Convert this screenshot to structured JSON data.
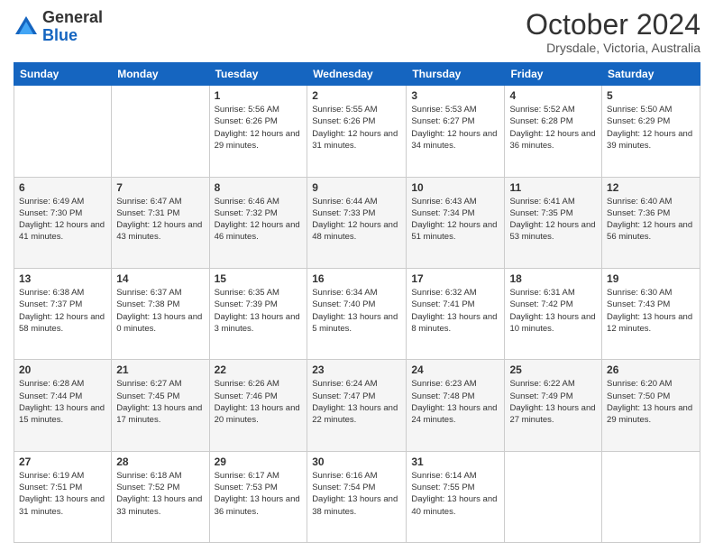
{
  "header": {
    "logo_general": "General",
    "logo_blue": "Blue",
    "month_title": "October 2024",
    "location": "Drysdale, Victoria, Australia"
  },
  "calendar": {
    "days_of_week": [
      "Sunday",
      "Monday",
      "Tuesday",
      "Wednesday",
      "Thursday",
      "Friday",
      "Saturday"
    ],
    "weeks": [
      [
        {
          "day": "",
          "info": ""
        },
        {
          "day": "",
          "info": ""
        },
        {
          "day": "1",
          "info": "Sunrise: 5:56 AM\nSunset: 6:26 PM\nDaylight: 12 hours and 29 minutes."
        },
        {
          "day": "2",
          "info": "Sunrise: 5:55 AM\nSunset: 6:26 PM\nDaylight: 12 hours and 31 minutes."
        },
        {
          "day": "3",
          "info": "Sunrise: 5:53 AM\nSunset: 6:27 PM\nDaylight: 12 hours and 34 minutes."
        },
        {
          "day": "4",
          "info": "Sunrise: 5:52 AM\nSunset: 6:28 PM\nDaylight: 12 hours and 36 minutes."
        },
        {
          "day": "5",
          "info": "Sunrise: 5:50 AM\nSunset: 6:29 PM\nDaylight: 12 hours and 39 minutes."
        }
      ],
      [
        {
          "day": "6",
          "info": "Sunrise: 6:49 AM\nSunset: 7:30 PM\nDaylight: 12 hours and 41 minutes."
        },
        {
          "day": "7",
          "info": "Sunrise: 6:47 AM\nSunset: 7:31 PM\nDaylight: 12 hours and 43 minutes."
        },
        {
          "day": "8",
          "info": "Sunrise: 6:46 AM\nSunset: 7:32 PM\nDaylight: 12 hours and 46 minutes."
        },
        {
          "day": "9",
          "info": "Sunrise: 6:44 AM\nSunset: 7:33 PM\nDaylight: 12 hours and 48 minutes."
        },
        {
          "day": "10",
          "info": "Sunrise: 6:43 AM\nSunset: 7:34 PM\nDaylight: 12 hours and 51 minutes."
        },
        {
          "day": "11",
          "info": "Sunrise: 6:41 AM\nSunset: 7:35 PM\nDaylight: 12 hours and 53 minutes."
        },
        {
          "day": "12",
          "info": "Sunrise: 6:40 AM\nSunset: 7:36 PM\nDaylight: 12 hours and 56 minutes."
        }
      ],
      [
        {
          "day": "13",
          "info": "Sunrise: 6:38 AM\nSunset: 7:37 PM\nDaylight: 12 hours and 58 minutes."
        },
        {
          "day": "14",
          "info": "Sunrise: 6:37 AM\nSunset: 7:38 PM\nDaylight: 13 hours and 0 minutes."
        },
        {
          "day": "15",
          "info": "Sunrise: 6:35 AM\nSunset: 7:39 PM\nDaylight: 13 hours and 3 minutes."
        },
        {
          "day": "16",
          "info": "Sunrise: 6:34 AM\nSunset: 7:40 PM\nDaylight: 13 hours and 5 minutes."
        },
        {
          "day": "17",
          "info": "Sunrise: 6:32 AM\nSunset: 7:41 PM\nDaylight: 13 hours and 8 minutes."
        },
        {
          "day": "18",
          "info": "Sunrise: 6:31 AM\nSunset: 7:42 PM\nDaylight: 13 hours and 10 minutes."
        },
        {
          "day": "19",
          "info": "Sunrise: 6:30 AM\nSunset: 7:43 PM\nDaylight: 13 hours and 12 minutes."
        }
      ],
      [
        {
          "day": "20",
          "info": "Sunrise: 6:28 AM\nSunset: 7:44 PM\nDaylight: 13 hours and 15 minutes."
        },
        {
          "day": "21",
          "info": "Sunrise: 6:27 AM\nSunset: 7:45 PM\nDaylight: 13 hours and 17 minutes."
        },
        {
          "day": "22",
          "info": "Sunrise: 6:26 AM\nSunset: 7:46 PM\nDaylight: 13 hours and 20 minutes."
        },
        {
          "day": "23",
          "info": "Sunrise: 6:24 AM\nSunset: 7:47 PM\nDaylight: 13 hours and 22 minutes."
        },
        {
          "day": "24",
          "info": "Sunrise: 6:23 AM\nSunset: 7:48 PM\nDaylight: 13 hours and 24 minutes."
        },
        {
          "day": "25",
          "info": "Sunrise: 6:22 AM\nSunset: 7:49 PM\nDaylight: 13 hours and 27 minutes."
        },
        {
          "day": "26",
          "info": "Sunrise: 6:20 AM\nSunset: 7:50 PM\nDaylight: 13 hours and 29 minutes."
        }
      ],
      [
        {
          "day": "27",
          "info": "Sunrise: 6:19 AM\nSunset: 7:51 PM\nDaylight: 13 hours and 31 minutes."
        },
        {
          "day": "28",
          "info": "Sunrise: 6:18 AM\nSunset: 7:52 PM\nDaylight: 13 hours and 33 minutes."
        },
        {
          "day": "29",
          "info": "Sunrise: 6:17 AM\nSunset: 7:53 PM\nDaylight: 13 hours and 36 minutes."
        },
        {
          "day": "30",
          "info": "Sunrise: 6:16 AM\nSunset: 7:54 PM\nDaylight: 13 hours and 38 minutes."
        },
        {
          "day": "31",
          "info": "Sunrise: 6:14 AM\nSunset: 7:55 PM\nDaylight: 13 hours and 40 minutes."
        },
        {
          "day": "",
          "info": ""
        },
        {
          "day": "",
          "info": ""
        }
      ]
    ]
  }
}
